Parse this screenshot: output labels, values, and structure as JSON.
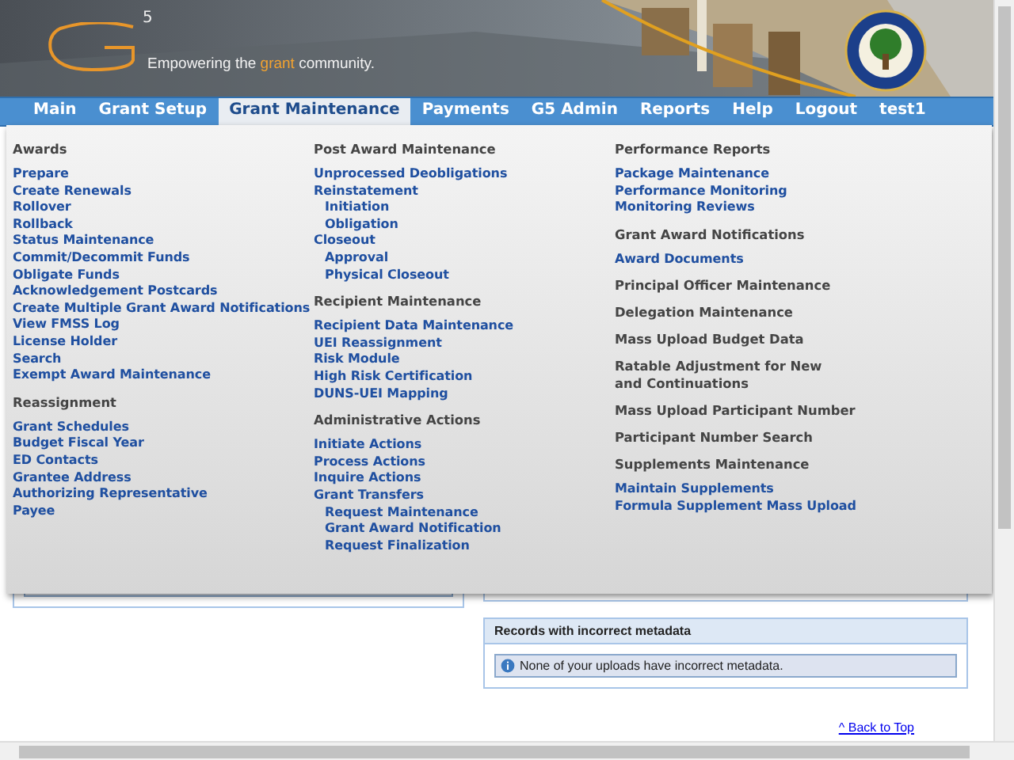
{
  "header": {
    "logo_superscript": "5",
    "tagline": {
      "before": "Empowering the ",
      "highlight": "grant",
      "after": " community."
    }
  },
  "nav": [
    {
      "label": "Main",
      "selected": false
    },
    {
      "label": "Grant Setup",
      "selected": false
    },
    {
      "label": "Grant Maintenance",
      "selected": true
    },
    {
      "label": "Payments",
      "selected": false
    },
    {
      "label": "G5 Admin",
      "selected": false
    },
    {
      "label": "Reports",
      "selected": false
    },
    {
      "label": "Help",
      "selected": false
    },
    {
      "label": "Logout",
      "selected": false
    },
    {
      "label": "test1",
      "selected": false
    }
  ],
  "menu": {
    "columns": [
      [
        {
          "heading": "Awards",
          "links": [
            {
              "label": "Prepare"
            },
            {
              "label": "Create Renewals"
            },
            {
              "label": "Rollover"
            },
            {
              "label": "Rollback"
            },
            {
              "label": "Status Maintenance"
            },
            {
              "label": "Commit/Decommit Funds"
            },
            {
              "label": "Obligate Funds"
            },
            {
              "label": "Acknowledgement Postcards"
            },
            {
              "label": "Create Multiple Grant Award Notifications"
            },
            {
              "label": "View FMSS Log"
            },
            {
              "label": "License Holder"
            },
            {
              "label": "Search"
            },
            {
              "label": "Exempt Award Maintenance"
            }
          ]
        },
        {
          "heading": "Reassignment",
          "links": [
            {
              "label": "Grant Schedules"
            },
            {
              "label": "Budget Fiscal Year"
            },
            {
              "label": "ED Contacts"
            },
            {
              "label": "Grantee Address"
            },
            {
              "label": "Authorizing Representative"
            },
            {
              "label": "Payee"
            }
          ]
        }
      ],
      [
        {
          "heading": "Post Award Maintenance",
          "links": [
            {
              "label": "Unprocessed Deobligations"
            },
            {
              "label": "Reinstatement",
              "children": [
                {
                  "label": "Initiation"
                },
                {
                  "label": "Obligation"
                }
              ]
            },
            {
              "label": "Closeout",
              "children": [
                {
                  "label": "Approval"
                },
                {
                  "label": "Physical Closeout"
                }
              ]
            }
          ]
        },
        {
          "heading": "Recipient Maintenance",
          "links": [
            {
              "label": "Recipient Data Maintenance"
            },
            {
              "label": "UEI Reassignment"
            },
            {
              "label": "Risk Module"
            },
            {
              "label": "High Risk Certification"
            },
            {
              "label": "DUNS-UEI Mapping"
            }
          ]
        },
        {
          "heading": "Administrative Actions",
          "links": [
            {
              "label": "Initiate Actions"
            },
            {
              "label": "Process Actions"
            },
            {
              "label": "Inquire Actions"
            },
            {
              "label": "Grant Transfers",
              "children": [
                {
                  "label": "Request Maintenance"
                },
                {
                  "label": "Grant Award Notification"
                },
                {
                  "label": "Request Finalization"
                }
              ]
            }
          ]
        }
      ],
      [
        {
          "heading": "Performance Reports",
          "links": [
            {
              "label": "Package Maintenance"
            },
            {
              "label": "Performance Monitoring"
            },
            {
              "label": "Monitoring Reviews"
            }
          ]
        },
        {
          "heading": "Grant Award Notifications",
          "links": [
            {
              "label": "Award Documents"
            }
          ]
        },
        {
          "heading": "Principal Officer Maintenance"
        },
        {
          "heading": "Delegation Maintenance"
        },
        {
          "heading": "Mass Upload Budget Data"
        },
        {
          "heading": "Ratable Adjustment for New and Continuations"
        },
        {
          "heading": "Mass Upload Participant Number"
        },
        {
          "heading": "Participant Number Search"
        },
        {
          "heading": "Supplements Maintenance",
          "links": [
            {
              "label": "Maintain Supplements"
            },
            {
              "label": "Formula Supplement Mass Upload"
            }
          ]
        }
      ]
    ]
  },
  "metadata_panel": {
    "title": "Records with incorrect metadata",
    "message": "None of your uploads have incorrect metadata."
  },
  "back_to_top": "^ Back to Top"
}
